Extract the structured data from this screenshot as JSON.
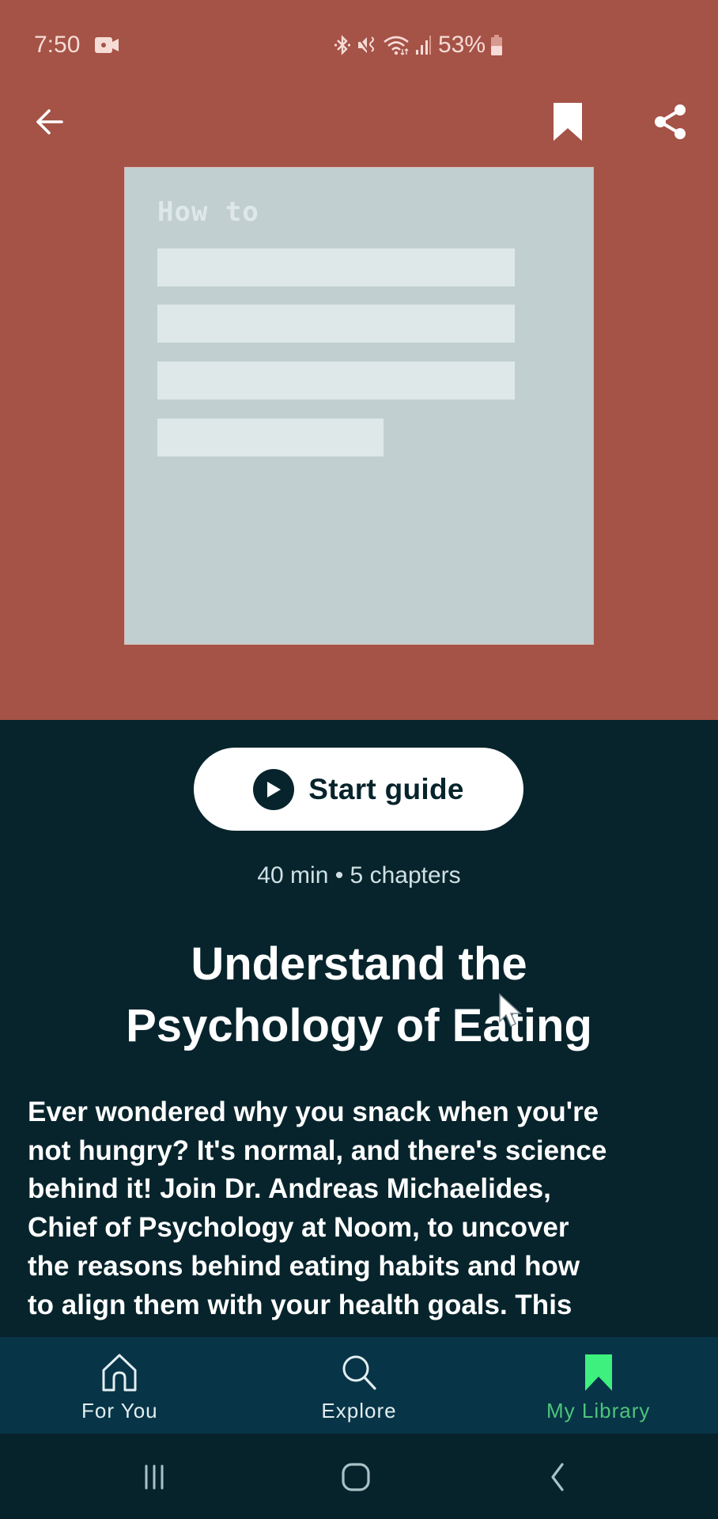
{
  "status_bar": {
    "time": "7:50",
    "battery_percent": "53%",
    "left_icons": [
      "video-record-icon"
    ],
    "right_icons": [
      "bluetooth-icon",
      "mute-vibrate-icon",
      "wifi-icon",
      "signal-icon",
      "battery-icon"
    ]
  },
  "header": {
    "back_icon": "arrow-left-icon",
    "bookmark_icon": "bookmark-filled-icon",
    "share_icon": "share-icon"
  },
  "cover": {
    "label": "How to",
    "placeholder_lines": 4
  },
  "guide": {
    "start_label": "Start guide",
    "play_icon": "play-circle-icon",
    "meta": "40 min • 5 chapters",
    "title_lines": [
      "Understand the",
      "Psychology of Eating"
    ],
    "description_lines": [
      "Ever wondered why you snack when you're",
      "not hungry? It's normal, and there's science",
      "behind it! Join Dr. Andreas Michaelides,",
      "Chief of Psychology at Noom, to uncover",
      "the reasons behind eating habits and how",
      "to align them with your health goals. This"
    ]
  },
  "bottom_nav": {
    "items": [
      {
        "label": "For You",
        "icon": "home-icon",
        "active": false
      },
      {
        "label": "Explore",
        "icon": "search-icon",
        "active": false
      },
      {
        "label": "My Library",
        "icon": "bookmark-icon",
        "active": true
      }
    ]
  },
  "system_nav": [
    "recent-apps-icon",
    "home-circle-icon",
    "back-chevron-icon"
  ],
  "colors": {
    "hero_bg": "#a55247",
    "page_bg": "#07242c",
    "nav_bg": "#073447",
    "active_accent": "#3ef07e",
    "active_label": "#4cc57a",
    "cover_bg": "#c1cfd0"
  }
}
